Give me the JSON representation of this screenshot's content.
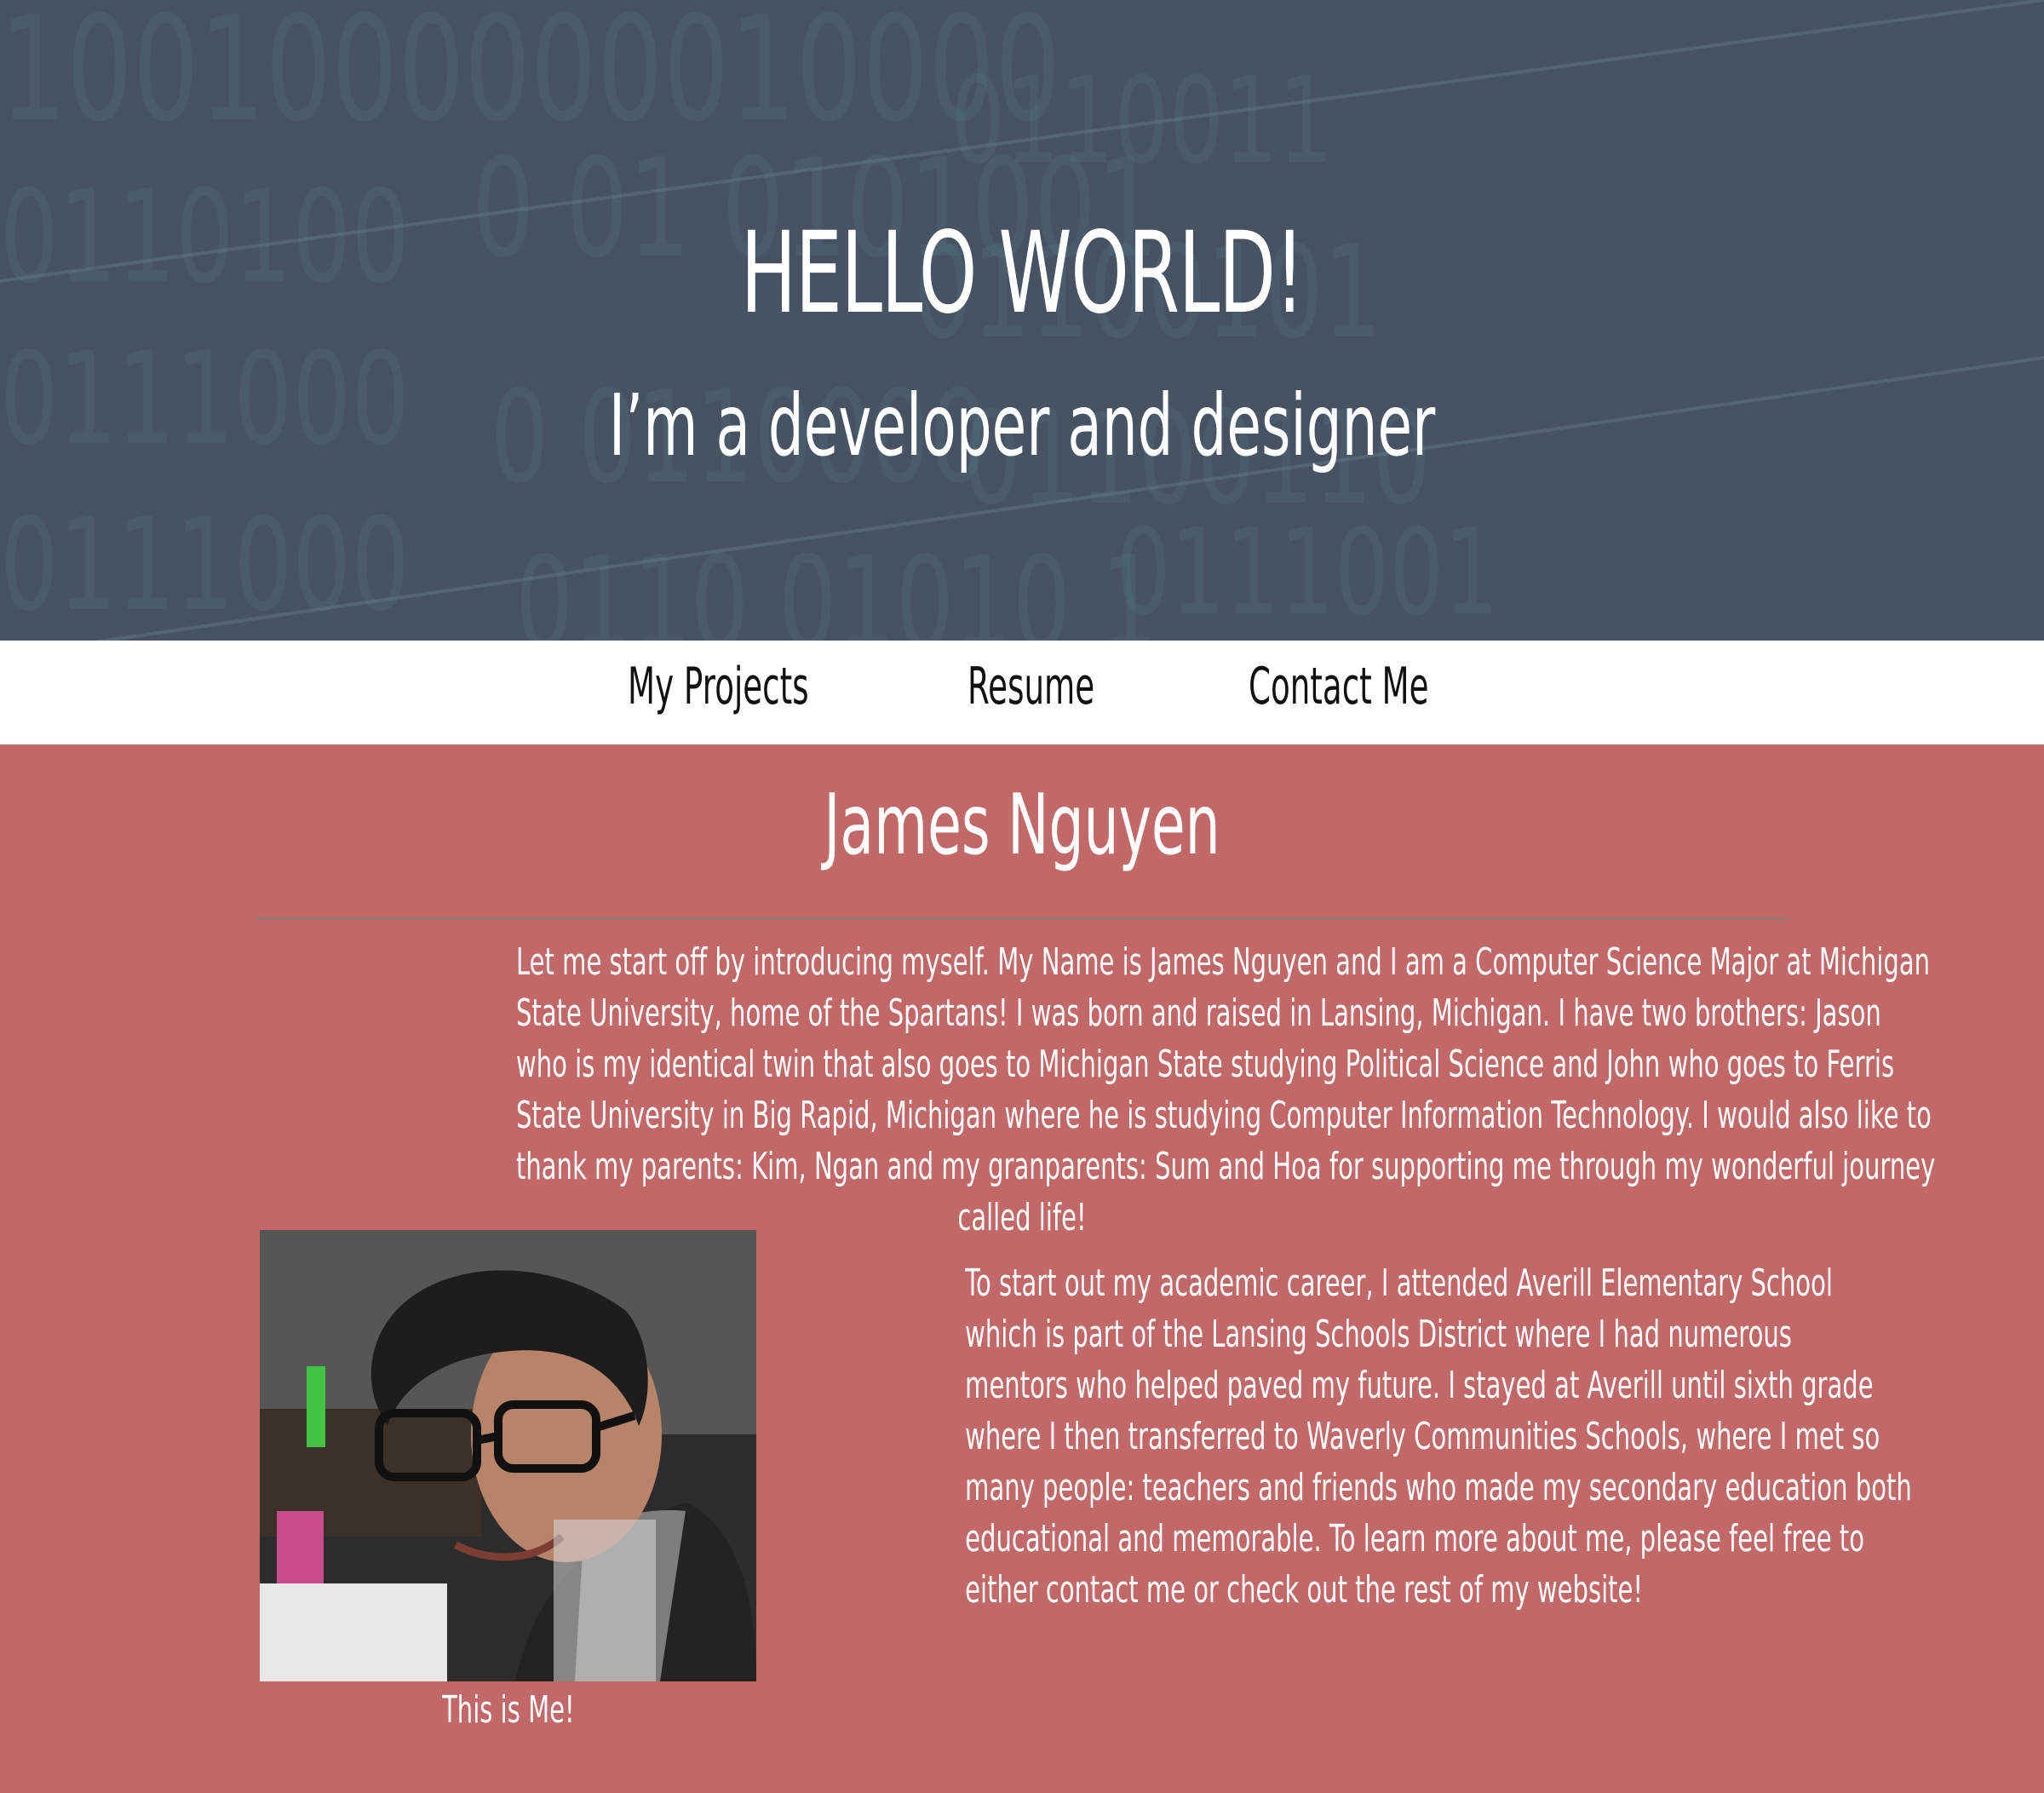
{
  "hero": {
    "title": "HELLO WORLD!",
    "subtitle": "I’m a developer and designer",
    "background_pattern": "binary digits"
  },
  "nav": {
    "items": [
      {
        "label": "My Projects"
      },
      {
        "label": "Resume"
      },
      {
        "label": "Contact Me"
      }
    ]
  },
  "main": {
    "name": "James Nguyen",
    "intro_lines": [
      "Let me start off by introducing myself. My Name is James Nguyen and I am a Computer Science Major at Michigan",
      "State University, home of the Spartans! I was born and raised in Lansing, Michigan. I have two brothers: Jason",
      "who is my identical twin that also goes to Michigan State studying Political Science and John who goes to Ferris",
      "State University in Big Rapid, Michigan where he is studying Computer Information Technology. I would also like to",
      "thank my parents: Kim, Ngan and my granparents: Sum and Hoa for supporting me through my wonderful journey",
      "called life!"
    ],
    "photo_caption": "This is Me!",
    "academic_lines": [
      "To start out my academic career, I attended Averill Elementary School",
      "which is part of the Lansing Schools District where I had numerous",
      "mentors who helped paved my future. I stayed at Averill until sixth grade",
      "where I then transferred to Waverly Communities Schools, where I met so",
      "many people: teachers and friends who made my secondary education both",
      "educational and memorable.  To learn more about me, please feel free to",
      "either contact me or check out the rest of my website!"
    ]
  },
  "colors": {
    "hero_bg": "#475263",
    "nav_bg": "#ffffff",
    "main_bg": "#c26868",
    "text_light": "#ffffff",
    "nav_text": "#111111"
  }
}
